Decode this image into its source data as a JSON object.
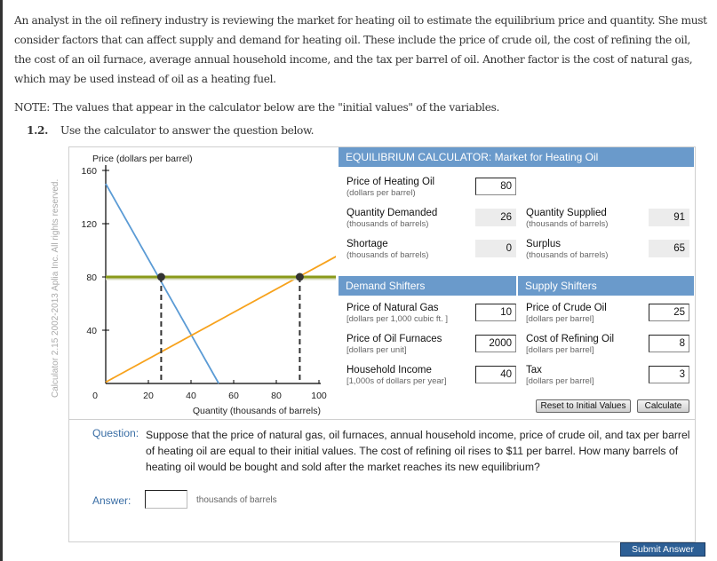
{
  "intro": {
    "paragraph": "An analyst in the oil refinery industry is reviewing the market for heating oil to estimate the equilibrium price and quantity. She must consider factors that can affect supply and demand for heating oil. These include the price of crude oil, the cost of refining the oil, the cost of an oil furnace, average annual household income, and the tax per barrel of oil. Another factor is the cost of natural gas, which may be used instead of oil as a heating fuel.",
    "note": "NOTE: The values that appear in the calculator below are the \"initial values\" of the variables.",
    "question_number": "1.2.",
    "instruction": "Use the calculator to answer the question below."
  },
  "copyright": "Calculator 2.15  2002-2013 Aplia Inc. All rights reserved.",
  "chart_data": {
    "type": "line",
    "title": "",
    "ylabel": "Price (dollars per barrel)",
    "xlabel": "Quantity (thousands of barrels)",
    "xlim": [
      0,
      100
    ],
    "ylim": [
      0,
      160
    ],
    "xticks": [
      "0",
      "20",
      "40",
      "60",
      "80",
      "100"
    ],
    "xtick_values": [
      0,
      20,
      40,
      60,
      80,
      100
    ],
    "yticks": [
      "40",
      "80",
      "120",
      "160"
    ],
    "ytick_values": [
      40,
      80,
      120,
      160
    ],
    "series": [
      {
        "name": "Demand",
        "color": "#5b9bd5",
        "points": [
          [
            0,
            150
          ],
          [
            53,
            0
          ]
        ]
      },
      {
        "name": "Supply",
        "color": "#f7a21c",
        "points": [
          [
            0,
            1
          ],
          [
            100,
            91
          ]
        ]
      },
      {
        "name": "Price",
        "color": "#8a9a1a",
        "points": [
          [
            0,
            80
          ],
          [
            100,
            80
          ]
        ]
      }
    ],
    "markers": [
      {
        "name": "quantity-demanded-point",
        "x": 26,
        "y": 80
      },
      {
        "name": "quantity-supplied-point",
        "x": 91,
        "y": 80
      }
    ],
    "grid": false
  },
  "calculator": {
    "title": "EQUILIBRIUM CALCULATOR: Market for Heating Oil",
    "price": {
      "label": "Price of Heating Oil",
      "unit": "(dollars per barrel)",
      "value": "80"
    },
    "quantity_demanded": {
      "label": "Quantity Demanded",
      "unit": "(thousands of barrels)",
      "value": "26"
    },
    "quantity_supplied": {
      "label": "Quantity Supplied",
      "unit": "(thousands of barrels)",
      "value": "91"
    },
    "shortage": {
      "label": "Shortage",
      "unit": "(thousands of barrels)",
      "value": "0"
    },
    "surplus": {
      "label": "Surplus",
      "unit": "(thousands of barrels)",
      "value": "65"
    },
    "demand_shifters_title": "Demand Shifters",
    "supply_shifters_title": "Supply Shifters",
    "demand_shifters": [
      {
        "label": "Price of Natural Gas",
        "unit": "[dollars per 1,000 cubic ft. ]",
        "value": "10"
      },
      {
        "label": "Price of Oil Furnaces",
        "unit": "[dollars per unit]",
        "value": "2000"
      },
      {
        "label": "Household Income",
        "unit": "[1,000s of dollars per year]",
        "value": "40"
      }
    ],
    "supply_shifters": [
      {
        "label": "Price of Crude Oil",
        "unit": "[dollars per barrel]",
        "value": "25"
      },
      {
        "label": "Cost of Refining Oil",
        "unit": "[dollars per barrel]",
        "value": "8"
      },
      {
        "label": "Tax",
        "unit": "[dollars per barrel]",
        "value": "3"
      }
    ],
    "reset_label": "Reset to Initial Values",
    "calculate_label": "Calculate"
  },
  "question": {
    "label": "Question:",
    "text": "Suppose that the price of natural gas, oil furnaces, annual household income, price of crude oil, and tax per barrel of heating oil are equal to their initial values. The cost of refining oil rises to $11 per barrel. How many barrels of heating oil would be bought and sold after the market reaches its new equilibrium?"
  },
  "answer": {
    "label": "Answer:",
    "value": "",
    "unit": "thousands of barrels"
  },
  "submit_label": "Submit Answer"
}
